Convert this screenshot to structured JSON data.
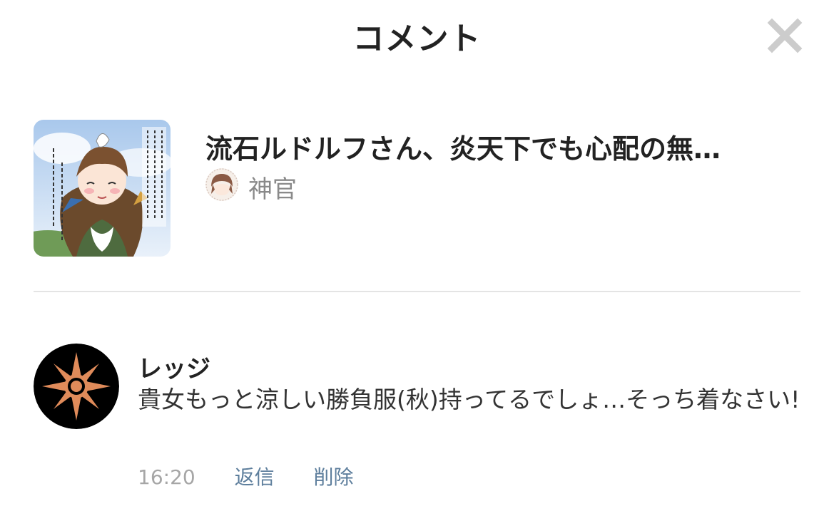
{
  "header": {
    "title": "コメント",
    "close_icon": "close-icon"
  },
  "post": {
    "thumbnail_icon": "post-thumbnail",
    "title": "流石ルドルフさん、炎天下でも心配の無…",
    "author": {
      "avatar_icon": "author-avatar",
      "name": "神官"
    }
  },
  "comment": {
    "avatar_icon": "compass-star-avatar",
    "user": "レッジ",
    "text": "貴女もっと涼しい勝負服(秋)持ってるでしょ…そっち着なさい!",
    "time": "16:20",
    "actions": {
      "reply": "返信",
      "delete": "削除"
    }
  },
  "colors": {
    "text_primary": "#222222",
    "text_secondary": "#8a8a8a",
    "time": "#a6a6a6",
    "action_link": "#5d7e9c",
    "divider": "#e4e4e4",
    "close_icon": "#cccccc",
    "avatar_bg": "#000000",
    "avatar_star": "#e08b5a"
  }
}
